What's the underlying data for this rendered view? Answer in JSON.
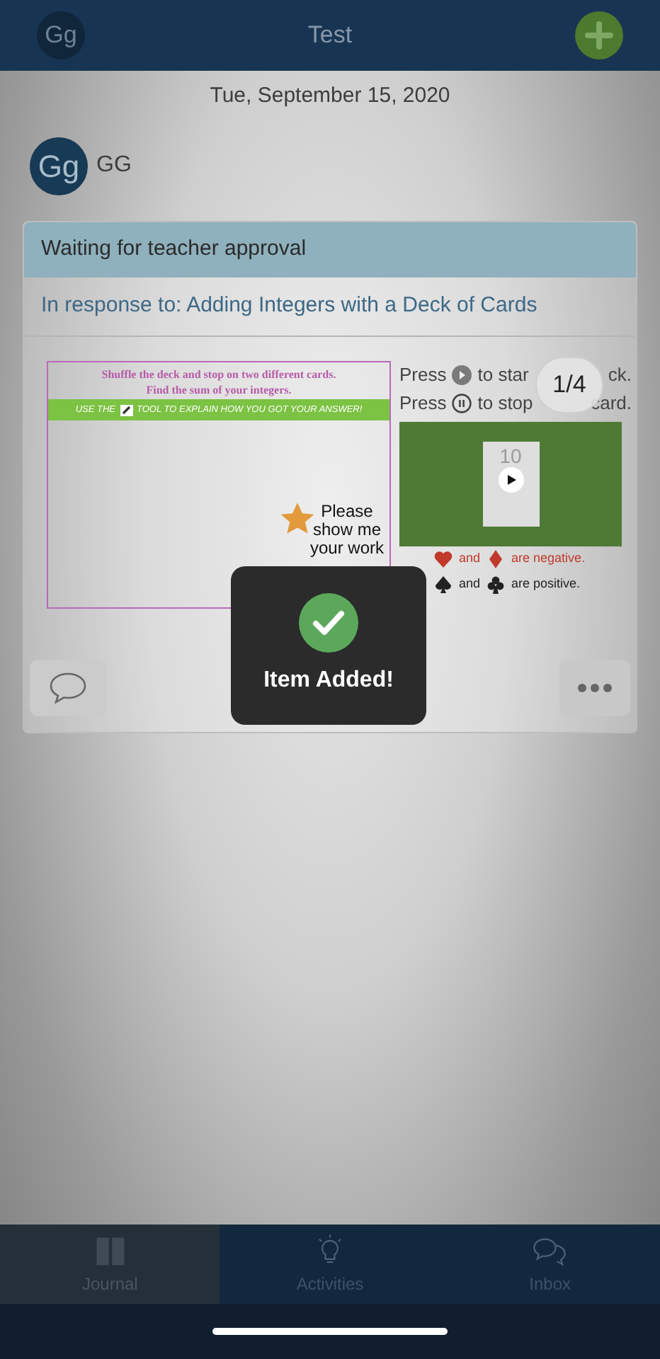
{
  "header": {
    "avatar": "Gg",
    "title": "Test"
  },
  "date": "Tue, September 15, 2020",
  "author": {
    "avatar": "Gg",
    "name": "GG"
  },
  "post": {
    "status": "Waiting for teacher approval",
    "response": "In response to: Adding Integers with a Deck of Cards",
    "slide": {
      "heading": "Shuffle the deck and stop on two different cards.",
      "subheading": "Find the sum of your integers.",
      "banner_before": "USE THE",
      "banner_after": "TOOL TO EXPLAIN HOW YOU GOT YOUR ANSWER!",
      "note": [
        "Please",
        "show me",
        "your work"
      ],
      "instructions": [
        {
          "kind": "play",
          "before": "Press",
          "after": "to star",
          "end": "ck."
        },
        {
          "kind": "pause",
          "before": "Press",
          "after": "to stop",
          "end": "card."
        }
      ],
      "video": {
        "card": "10"
      },
      "legend": [
        {
          "and": "and",
          "text": "are negative.",
          "color": "#c0392b"
        },
        {
          "and": "and",
          "text": "are positive.",
          "color": "#222222"
        }
      ]
    },
    "page_indicator": "1/4"
  },
  "toast": {
    "message": "Item Added!"
  },
  "tabs": [
    {
      "label": "Journal",
      "selected": true
    },
    {
      "label": "Activities",
      "selected": false
    },
    {
      "label": "Inbox",
      "selected": false
    }
  ]
}
